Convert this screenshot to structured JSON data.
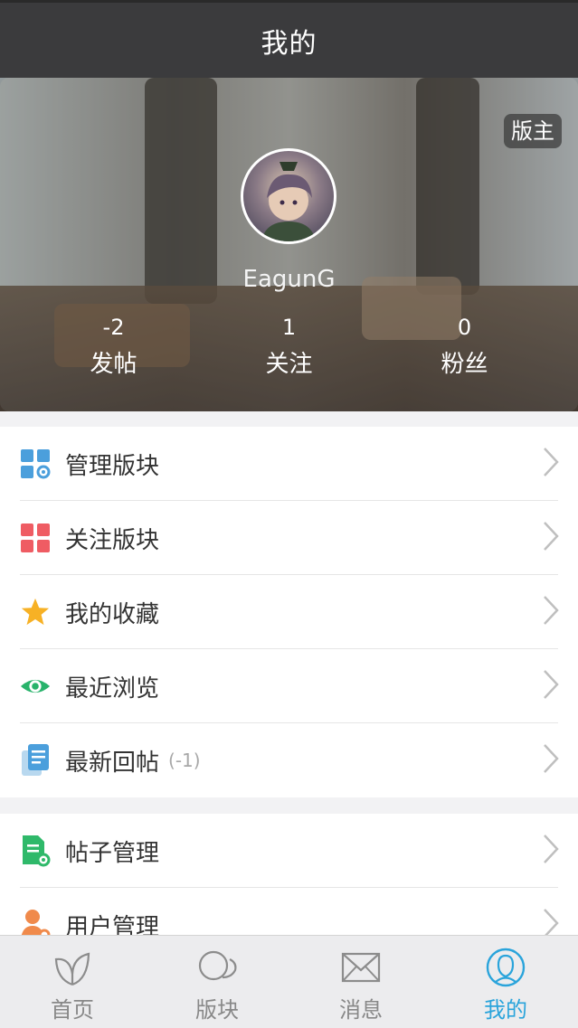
{
  "header": {
    "title": "我的"
  },
  "profile": {
    "role_badge": "版主",
    "username": "EagunG",
    "stats": [
      {
        "value": "-2",
        "label": "发帖"
      },
      {
        "value": "1",
        "label": "关注"
      },
      {
        "value": "0",
        "label": "粉丝"
      }
    ]
  },
  "menu_group1": [
    {
      "label": "管理版块",
      "icon": "manage-forums-icon"
    },
    {
      "label": "关注版块",
      "icon": "followed-forums-icon"
    },
    {
      "label": "我的收藏",
      "icon": "star-icon"
    },
    {
      "label": "最近浏览",
      "icon": "eye-icon"
    },
    {
      "label": "最新回帖",
      "count": "(-1)",
      "icon": "document-icon"
    }
  ],
  "menu_group2": [
    {
      "label": "帖子管理",
      "icon": "post-settings-icon"
    },
    {
      "label": "用户管理",
      "icon": "user-settings-icon"
    }
  ],
  "tabbar": [
    {
      "label": "首页",
      "icon": "leaf-icon"
    },
    {
      "label": "版块",
      "icon": "chat-bubbles-icon"
    },
    {
      "label": "消息",
      "icon": "envelope-icon"
    },
    {
      "label": "我的",
      "icon": "profile-icon",
      "active": true
    }
  ],
  "colors": {
    "accent": "#2aa4db",
    "topbar": "#3b3b3d"
  }
}
